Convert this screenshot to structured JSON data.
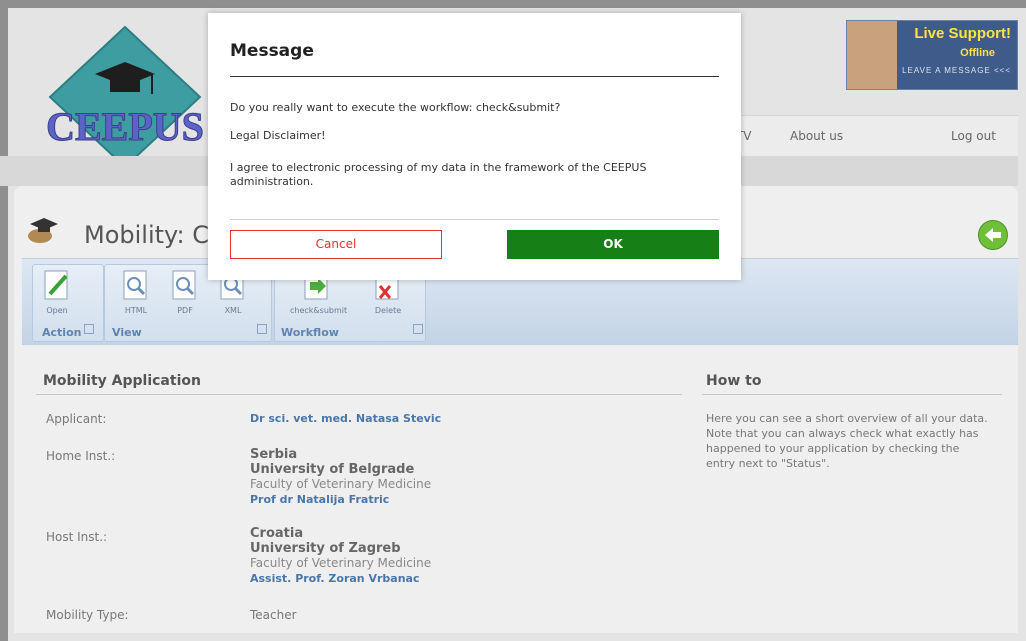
{
  "header": {
    "logo_text": "CEEPUS",
    "live_support": {
      "title": "Live Support!",
      "status": "Offline",
      "cta": "LEAVE A MESSAGE <<<"
    }
  },
  "nav": {
    "items": [
      "IS TV",
      "About us",
      "Log out"
    ]
  },
  "page": {
    "title": "Mobility: CI"
  },
  "ribbon": {
    "groups": [
      {
        "label": "Action",
        "buttons": [
          "Open"
        ]
      },
      {
        "label": "View",
        "buttons": [
          "HTML",
          "PDF",
          "XML"
        ]
      },
      {
        "label": "Workflow",
        "buttons": [
          "check&submit",
          "Delete"
        ]
      }
    ]
  },
  "form": {
    "section_title": "Mobility Application",
    "applicant_label": "Applicant:",
    "applicant_value": "Dr sci. vet. med. Natasa Stevic",
    "home_label": "Home Inst.:",
    "home_country": "Serbia",
    "home_university": "University of Belgrade",
    "home_faculty": "Faculty of Veterinary Medicine",
    "home_contact": "Prof dr Natalija Fratric",
    "host_label": "Host Inst.:",
    "host_country": "Croatia",
    "host_university": "University of Zagreb",
    "host_faculty": "Faculty of Veterinary Medicine",
    "host_contact": "Assist. Prof. Zoran Vrbanac",
    "type_label": "Mobility Type:",
    "type_value": "Teacher"
  },
  "howto": {
    "title": "How to",
    "text": "Here you can see a short overview of all your data. Note that you can always check what exactly has happened to your application by checking the entry next to \"Status\"."
  },
  "modal": {
    "title": "Message",
    "question": "Do you really want to execute the workflow: check&submit?",
    "disclaimer": "Legal Disclaimer!",
    "agreement": "I agree to electronic processing of my data in the framework of the CEEPUS administration.",
    "cancel_label": "Cancel",
    "ok_label": "OK"
  },
  "colors": {
    "ok_green": "#167f16",
    "cancel_red": "#dd3333",
    "link_blue": "#4a76a8"
  }
}
